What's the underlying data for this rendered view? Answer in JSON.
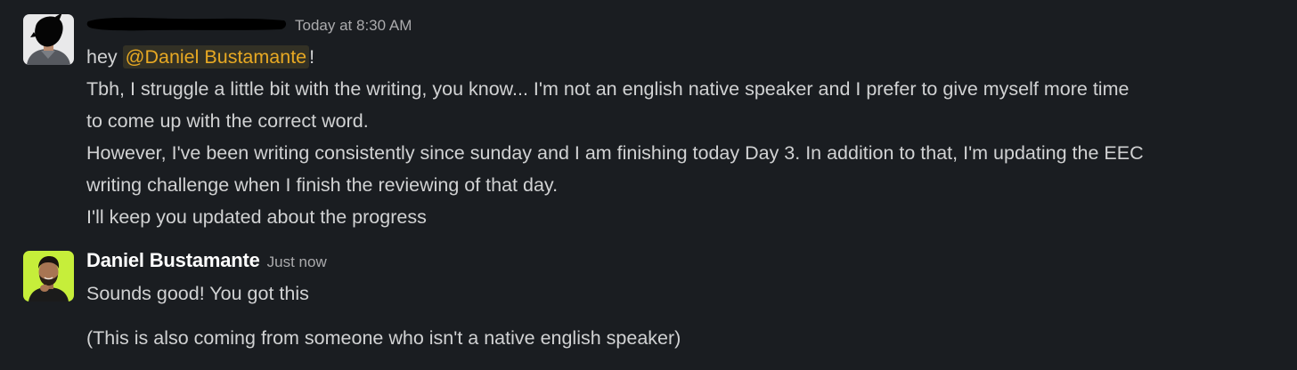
{
  "messages": [
    {
      "sender_name": "",
      "timestamp": "Today at 8:30 AM",
      "greeting": "hey ",
      "mention": "@Daniel Bustamante",
      "greeting_end": "!",
      "lines": [
        "Tbh, I struggle a little bit with the writing, you know... I'm not an english native speaker and I prefer to give myself more time",
        "to come up with the correct word.",
        "However, I've been writing consistently since sunday and I am finishing today Day 3. In addition to that, I'm updating the EEC",
        "writing challenge when I finish the reviewing of that day.",
        "I'll keep you updated about the progress"
      ]
    },
    {
      "sender_name": "Daniel Bustamante",
      "timestamp": "Just now",
      "lines": [
        "Sounds good! You got this",
        "(This is also coming from someone who isn't a native english speaker)"
      ]
    }
  ],
  "colors": {
    "background": "#1a1d21",
    "text": "#d1d2d3",
    "mention": "#e8a923",
    "timestamp": "#ababad",
    "avatar_green": "#c6ee3a"
  },
  "icons": [
    "avatar-user-redacted",
    "avatar-daniel-bustamante"
  ]
}
